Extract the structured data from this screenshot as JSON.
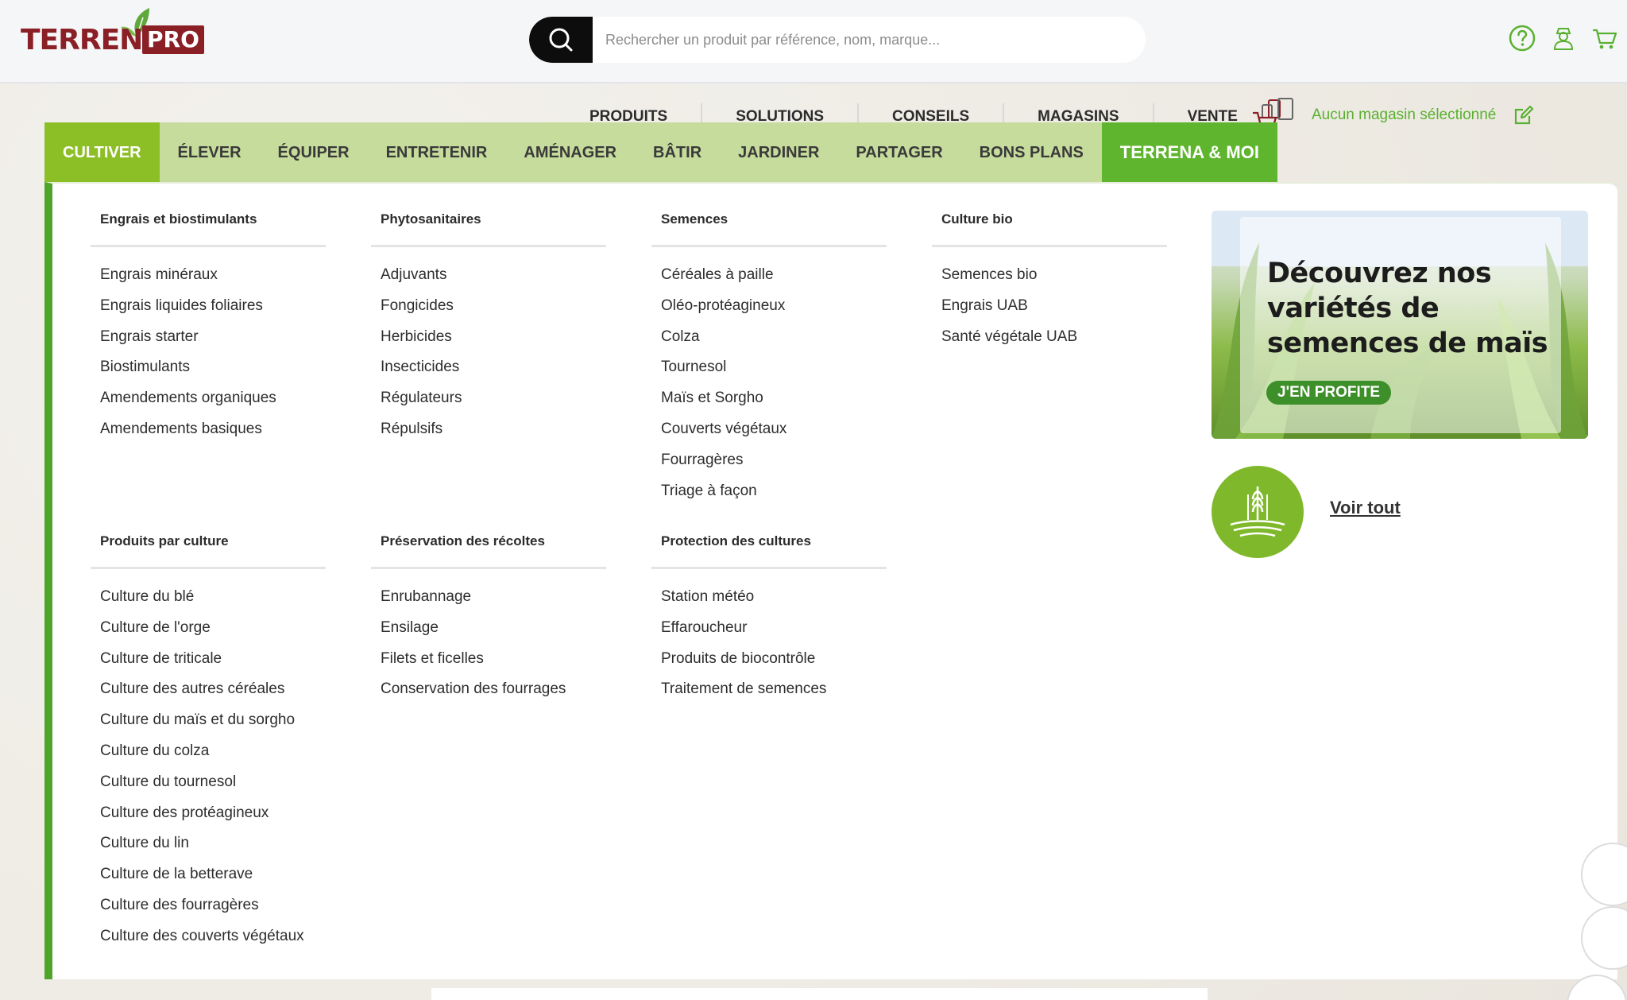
{
  "logo": {
    "word": "TERRENA",
    "badge": "PRO"
  },
  "search": {
    "placeholder": "Rechercher un produit par référence, nom, marque..."
  },
  "header_icons": [
    "help-icon",
    "account-icon",
    "cart-icon"
  ],
  "subnav": [
    "PRODUITS",
    "SOLUTIONS",
    "CONSEILS",
    "MAGASINS",
    "VENTE"
  ],
  "store": {
    "label": "Aucun magasin sélectionné"
  },
  "menu": {
    "items": [
      "CULTIVER",
      "ÉLEVER",
      "ÉQUIPER",
      "ENTRETENIR",
      "AMÉNAGER",
      "BÂTIR",
      "JARDINER",
      "PARTAGER",
      "BONS PLANS"
    ],
    "moi": "TERRENA & MOI",
    "active": "CULTIVER"
  },
  "columns": [
    {
      "title": "Engrais et biostimulants",
      "items": [
        "Engrais minéraux",
        "Engrais liquides foliaires",
        "Engrais starter",
        "Biostimulants",
        "Amendements organiques",
        "Amendements basiques"
      ]
    },
    {
      "title": "Phytosanitaires",
      "items": [
        "Adjuvants",
        "Fongicides",
        "Herbicides",
        "Insecticides",
        "Régulateurs",
        "Répulsifs"
      ]
    },
    {
      "title": "Semences",
      "items": [
        "Céréales à paille",
        "Oléo-protéagineux",
        "Colza",
        "Tournesol",
        "Maïs et Sorgho",
        "Couverts végétaux",
        "Fourragères",
        "Triage à façon"
      ]
    },
    {
      "title": "Culture bio",
      "items": [
        "Semences bio",
        "Engrais UAB",
        "Santé végétale UAB"
      ]
    },
    {
      "title": "Produits par culture",
      "items": [
        "Culture du blé",
        "Culture de l'orge",
        "Culture de triticale",
        "Culture des autres céréales",
        "Culture du maïs et du sorgho",
        "Culture du colza",
        "Culture du tournesol",
        "Culture des protéagineux",
        "Culture du lin",
        "Culture de la betterave",
        "Culture des fourragères",
        "Culture des couverts végétaux"
      ]
    },
    {
      "title": "Préservation des récoltes",
      "items": [
        "Enrubannage",
        "Ensilage",
        "Filets et ficelles",
        "Conservation des fourrages"
      ]
    },
    {
      "title": "Protection des cultures",
      "items": [
        "Station météo",
        "Effaroucheur",
        "Produits de biocontrôle",
        "Traitement de semences"
      ]
    }
  ],
  "promo": {
    "title": "Découvrez nos variétés de semences de maïs",
    "cta": "J'EN PROFITE"
  },
  "voir_tout": "Voir tout",
  "colors": {
    "brand_red": "#8a1f26",
    "active_green": "#8cbf26",
    "dark_green": "#5fb52e",
    "menu_bar": "#c6dc9c",
    "store_green": "#5ab030"
  }
}
